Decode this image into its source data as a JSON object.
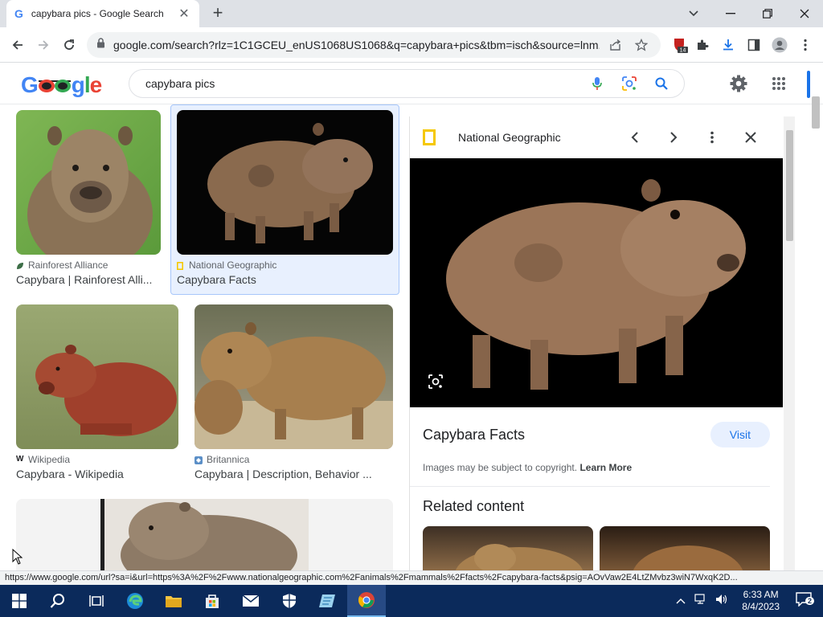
{
  "browser": {
    "tab_title": "capybara pics - Google Search",
    "tab_favicon": "G",
    "url": "google.com/search?rlz=1C1GCEU_enUS1068US1068&q=capybara+pics&tbm=isch&source=lnm...",
    "extension_badge": "14"
  },
  "google": {
    "logo": "Google",
    "query": "capybara pics"
  },
  "results": [
    {
      "source": "Rainforest Alliance",
      "title": "Capybara | Rainforest Alli..."
    },
    {
      "source": "National Geographic",
      "title": "Capybara Facts"
    },
    {
      "source": "Wikipedia",
      "title": "Capybara - Wikipedia"
    },
    {
      "source": "Britannica",
      "title": "Capybara | Description, Behavior ..."
    }
  ],
  "panel": {
    "source": "National Geographic",
    "title": "Capybara Facts",
    "visit_label": "Visit",
    "copyright_text": "Images may be subject to copyright.",
    "learn_more": "Learn More",
    "related_heading": "Related content"
  },
  "status_url": "https://www.google.com/url?sa=i&url=https%3A%2F%2Fwww.nationalgeographic.com%2Fanimals%2Fmammals%2Ffacts%2Fcapybara-facts&psig=AOvVaw2E4LtZMvbz3wiN7WxqK2D...",
  "taskbar": {
    "time": "6:33 AM",
    "date": "8/4/2023",
    "notification_count": "2"
  },
  "colors": {
    "accent": "#1a73e8",
    "natgeo_yellow": "#f5c800",
    "taskbar": "#0b2a5b"
  }
}
